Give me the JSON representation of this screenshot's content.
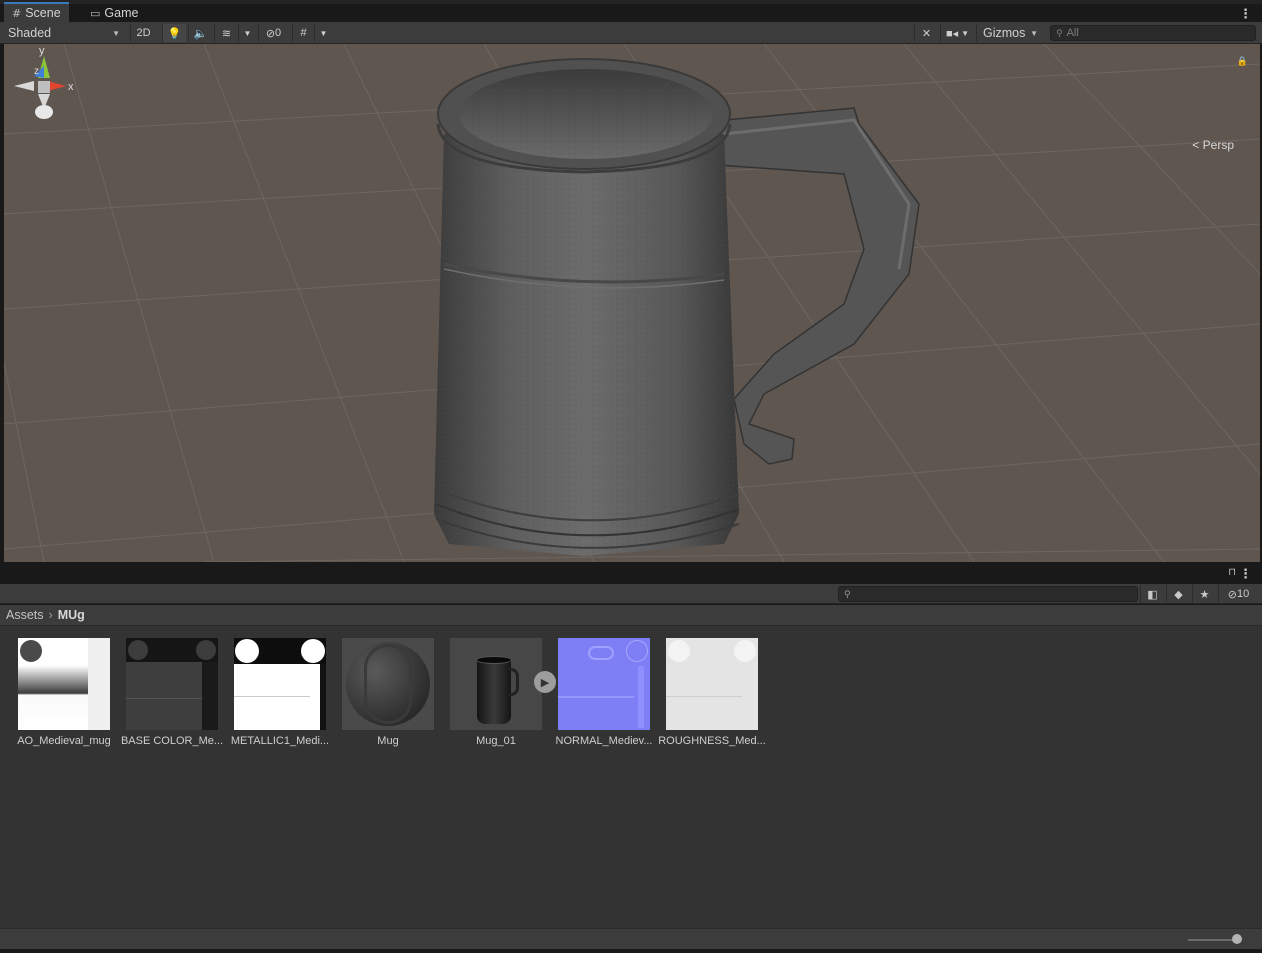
{
  "scene_window": {
    "tabs": [
      {
        "label": "Scene",
        "icon": "grid-icon"
      },
      {
        "label": "Game",
        "icon": "gamepad-icon"
      }
    ],
    "toolbar": {
      "draw_mode": "Shaded",
      "mode_2d": "2D",
      "hidden_count": "0",
      "gizmos_label": "Gizmos",
      "search_placeholder": "All"
    },
    "orientation_gizmo": {
      "y_label": "y",
      "z_label": "z",
      "x_label": "x",
      "projection": "Persp"
    }
  },
  "project_window": {
    "hidden_count": "10",
    "breadcrumb": [
      "Assets",
      "MUg"
    ],
    "assets": [
      {
        "label": "AO_Medieval_mug",
        "type": "texture-ao"
      },
      {
        "label": "BASE COLOR_Me...",
        "type": "texture-base"
      },
      {
        "label": "METALLIC1_Medi...",
        "type": "texture-metallic"
      },
      {
        "label": "Mug",
        "type": "material"
      },
      {
        "label": "Mug_01",
        "type": "model"
      },
      {
        "label": "NORMAL_Mediev...",
        "type": "texture-normal"
      },
      {
        "label": "ROUGHNESS_Med...",
        "type": "texture-roughness"
      }
    ]
  },
  "colors": {
    "accent": "#3a79bb",
    "scene_ground": "#5f5650",
    "panel": "#3c3c3c",
    "normal_map": "#7f7ff5"
  }
}
